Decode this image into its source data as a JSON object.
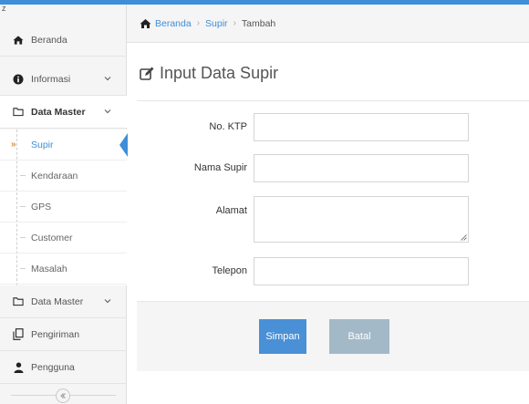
{
  "sidebar": {
    "top_char": "z",
    "items": [
      {
        "label": "Beranda",
        "icon": "home-icon"
      },
      {
        "label": "Informasi",
        "icon": "info-icon"
      },
      {
        "label": "Data Master",
        "icon": "folder-open-icon"
      },
      {
        "label": "Data Master",
        "icon": "folder-icon"
      },
      {
        "label": "Pengiriman",
        "icon": "copy-icon"
      },
      {
        "label": "Pengguna",
        "icon": "user-icon"
      }
    ],
    "submenu": [
      {
        "label": "Supir",
        "active": true
      },
      {
        "label": "Kendaraan"
      },
      {
        "label": "GPS"
      },
      {
        "label": "Customer"
      },
      {
        "label": "Masalah"
      }
    ]
  },
  "breadcrumb": {
    "home": "Beranda",
    "section": "Supir",
    "current": "Tambah"
  },
  "page": {
    "title": "Input Data Supir"
  },
  "form": {
    "ktp_label": "No. KTP",
    "nama_label": "Nama Supir",
    "alamat_label": "Alamat",
    "telepon_label": "Telepon",
    "ktp_value": "",
    "nama_value": "",
    "alamat_value": "",
    "telepon_value": ""
  },
  "actions": {
    "save_label": "Simpan",
    "cancel_label": "Batal"
  },
  "colors": {
    "accent": "#3e8ed8",
    "primary_button": "#4a90d6",
    "cancel_button": "#a4b9c7",
    "sidebar_bg": "#f5f5f5"
  }
}
